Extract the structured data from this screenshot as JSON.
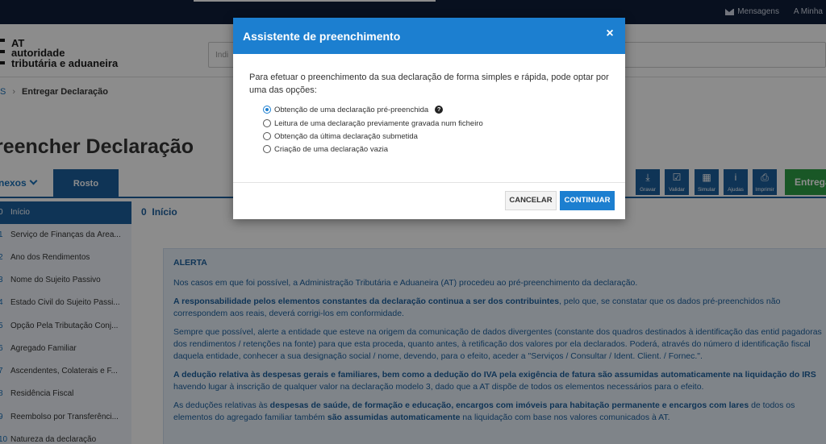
{
  "topbar": {
    "messages": "Mensagens",
    "my_area": "A Minha"
  },
  "header": {
    "logo_at": "AT",
    "logo_line1": "autoridade",
    "logo_line2": "tributária e aduaneira",
    "search_placeholder": "Indi"
  },
  "breadcrumb": {
    "prev": "S",
    "current": "Entregar Declaração"
  },
  "page_title": "reencher Declaração",
  "tabs": {
    "anexos": "nexos",
    "rosto": "Rosto"
  },
  "toolbar": {
    "buttons": [
      {
        "label": "Gravar",
        "icon": "download-icon"
      },
      {
        "label": "Validar",
        "icon": "check-icon"
      },
      {
        "label": "Simular",
        "icon": "calculator-icon"
      },
      {
        "label": "Ajudas",
        "icon": "info-icon"
      },
      {
        "label": "Imprimir",
        "icon": "printer-icon"
      }
    ],
    "submit": "Entregar"
  },
  "sidebar": {
    "items": [
      {
        "num": "0",
        "label": "Início"
      },
      {
        "num": "1",
        "label": "Serviço de Finanças da Área..."
      },
      {
        "num": "2",
        "label": "Ano dos Rendimentos"
      },
      {
        "num": "3",
        "label": "Nome do Sujeito Passivo"
      },
      {
        "num": "4",
        "label": "Estado Civil do Sujeito Passi..."
      },
      {
        "num": "5",
        "label": "Opção Pela Tributação Conj..."
      },
      {
        "num": "6",
        "label": "Agregado Familiar"
      },
      {
        "num": "7",
        "label": "Ascendentes, Colaterais e F..."
      },
      {
        "num": "8",
        "label": "Residência Fiscal"
      },
      {
        "num": "9",
        "label": "Reembolso por Transferênci..."
      },
      {
        "num": "10",
        "label": "Natureza da declaração"
      }
    ]
  },
  "main": {
    "heading_num": "0",
    "heading": "Início",
    "alert_title": "ALERTA",
    "p1": "Nos casos em que foi possível, a Administração Tributária e Aduaneira (AT) procedeu ao pré-preenchimento da declaração.",
    "p2_bold": "A responsabilidade pelos elementos constantes da declaração continua a ser dos contribuintes",
    "p2_rest": ", pelo que, se constatar que os dados pré-preenchidos não correspondem aos reais, deverá corrigi-los em conformidade.",
    "p3": "Sempre que possível, alerte a entidade que esteve na origem da comunicação de dados divergentes (constante dos quadros destinados à identificação das entid pagadoras dos rendimentos / retenções na fonte) para que esta proceda, quanto antes, à retificação dos valores por ela declarados. Poderá, através do número d identificação fiscal daquela entidade, conhecer a sua designação social / nome, devendo, para o efeito, aceder a \"Serviços / Consultar / Ident. Client. / Fornec.\".",
    "p4_bold": "A dedução relativa às despesas gerais e familiares, bem como a dedução do IVA pela exigência de fatura são assumidas automaticamente na liquidação do IRS",
    "p4_rest": " havendo lugar à inscrição de qualquer valor na declaração modelo 3, dado que a AT dispõe de todos os elementos necessários para o efeito.",
    "p5_a": "As deduções relativas às ",
    "p5_b": "despesas de saúde, de formação e educação, encargos com imóveis para habitação permanente e encargos com lares",
    "p5_c": " de todos os elementos do agregado familiar também ",
    "p5_d": "são assumidas automaticamente",
    "p5_e": " na liquidação com base nos valores comunicados à AT."
  },
  "modal": {
    "title": "Assistente de preenchimento",
    "intro": "Para efetuar o preenchimento da sua declaração de forma simples e rápida, pode optar por uma das opções:",
    "options": [
      "Obtenção de uma declaração pré-preenchida",
      "Leitura de uma declaração previamente gravada num ficheiro",
      "Obtenção da última declaração submetida",
      "Criação de uma declaração vazia"
    ],
    "selected_option": "Obtenção de uma declaração pré-preenchida",
    "help_glyph": "?",
    "cancel": "CANCELAR",
    "continue": "CONTINUAR"
  },
  "colors": {
    "topbar": "#0f1e3a",
    "primary": "#1c5f9d",
    "modal_header": "#1c7fd0",
    "submit": "#2f9e45"
  }
}
